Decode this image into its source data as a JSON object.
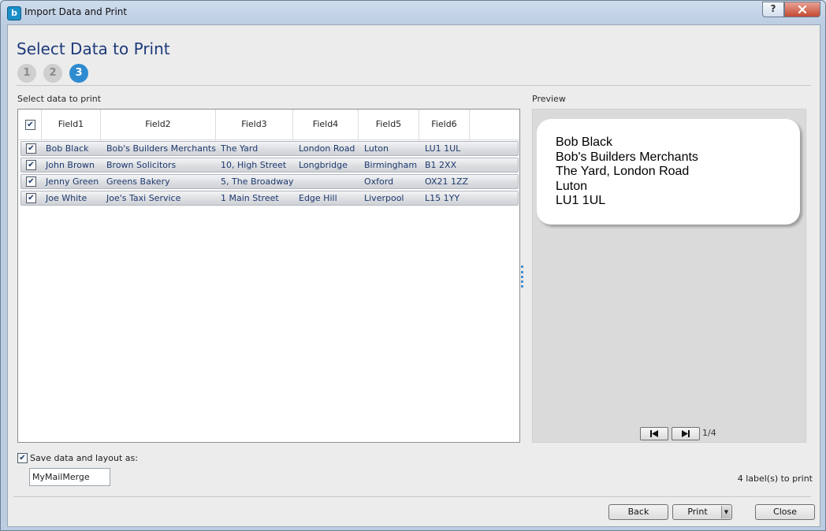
{
  "window": {
    "title": "Import Data and Print",
    "app_icon": "b",
    "help": "?",
    "close": "x"
  },
  "wizard": {
    "title": "Select Data to Print",
    "steps": [
      {
        "label": "1",
        "state": "done"
      },
      {
        "label": "2",
        "state": "done"
      },
      {
        "label": "3",
        "state": "active"
      }
    ]
  },
  "grid": {
    "label": "Select data to print",
    "select_all_checked": true,
    "columns": [
      "Field1",
      "Field2",
      "Field3",
      "Field4",
      "Field5",
      "Field6"
    ],
    "rows": [
      {
        "checked": true,
        "cells": [
          "Bob Black",
          "Bob's Builders Merchants",
          "The Yard",
          "London Road",
          "Luton",
          "LU1 1UL"
        ]
      },
      {
        "checked": true,
        "cells": [
          "John Brown",
          "Brown Solicitors",
          "10, High Street",
          "Longbridge",
          "Birmingham",
          "B1 2XX"
        ]
      },
      {
        "checked": true,
        "cells": [
          "Jenny Green",
          "Greens Bakery",
          "5, The Broadway",
          "",
          "Oxford",
          "OX21 1ZZ"
        ]
      },
      {
        "checked": true,
        "cells": [
          "Joe White",
          "Joe's Taxi Service",
          "1 Main Street",
          "Edge Hill",
          "Liverpool",
          "L15 1YY"
        ]
      }
    ]
  },
  "preview": {
    "label": "Preview",
    "lines": [
      "Bob Black",
      "Bob's Builders Merchants",
      "The Yard, London Road",
      "Luton",
      "LU1 1UL"
    ],
    "first_icon": "skip-previous-icon",
    "next_icon": "skip-next-icon",
    "page_indicator": "1/4"
  },
  "save": {
    "checked": true,
    "label": "Save data and layout as:",
    "value": "MyMailMerge"
  },
  "status": {
    "count_text": "4 label(s) to print"
  },
  "buttons": {
    "back": "Back",
    "print": "Print",
    "close": "Close"
  },
  "colors": {
    "title_blue": "#1d3a7a",
    "step_active": "#2e8bd0",
    "grid_text": "#1e3a6e"
  }
}
